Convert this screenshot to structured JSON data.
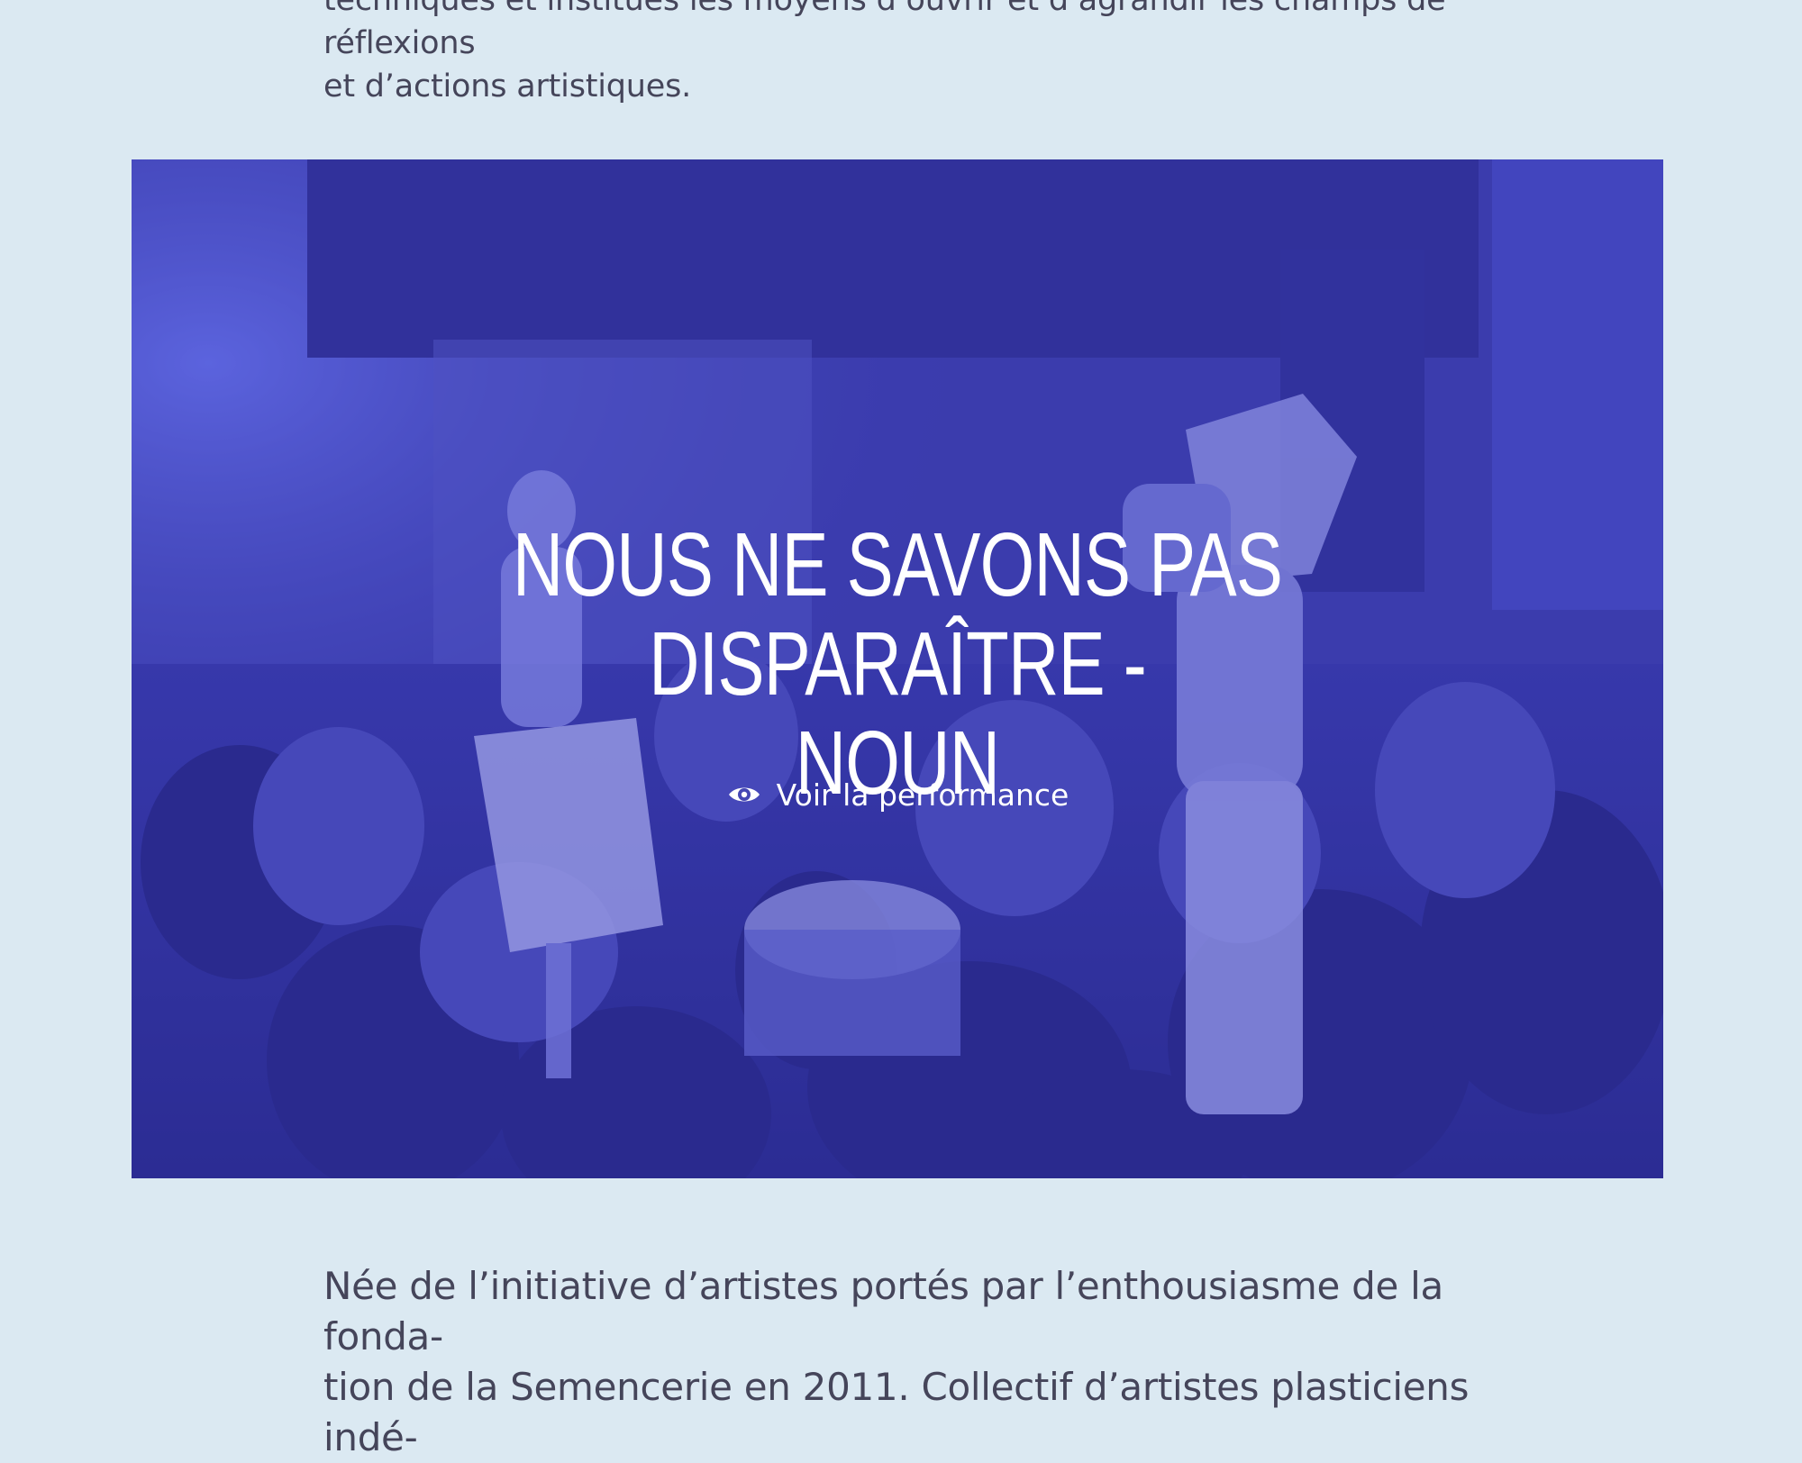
{
  "intro": {
    "line_1": "techniques et institués les moyens d’ouvrir et d’agrandir les champs de réflexions",
    "line_2": "et d’actions artistiques."
  },
  "hero": {
    "title_line_1": "NOUS NE SAVONS PAS DISPARAÎTRE -",
    "title_line_2": "NOUN",
    "cta_icon": "eye-icon",
    "cta_label": "Voir la performance"
  },
  "body": {
    "line_1": "Née de l’initiative d’artistes portés par l’enthousiasme de la fonda-",
    "line_2": "tion de la Semencerie en 2011. Collectif d’artistes plasticiens indé-"
  },
  "colors": {
    "page_background": "#dbe9f2",
    "hero_tint": "#3c3fa6",
    "text": "#45455a"
  }
}
